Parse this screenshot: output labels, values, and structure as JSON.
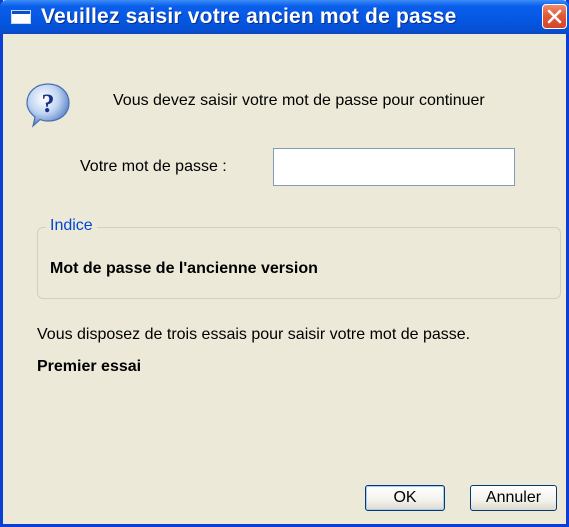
{
  "window": {
    "title": "Veuillez saisir votre ancien mot de passe"
  },
  "dialog": {
    "message": "Vous devez saisir votre mot de passe pour continuer",
    "password_label": "Votre mot de passe :",
    "password_value": "",
    "hint": {
      "legend": "Indice",
      "text": "Mot de passe de l'ancienne version"
    },
    "attempts_info": "Vous disposez de trois essais pour saisir votre mot de passe.",
    "attempt_status": "Premier essai"
  },
  "buttons": {
    "ok": "OK",
    "cancel": "Annuler"
  },
  "icons": {
    "title": "window-icon",
    "close": "close-icon",
    "help": "question-icon"
  }
}
